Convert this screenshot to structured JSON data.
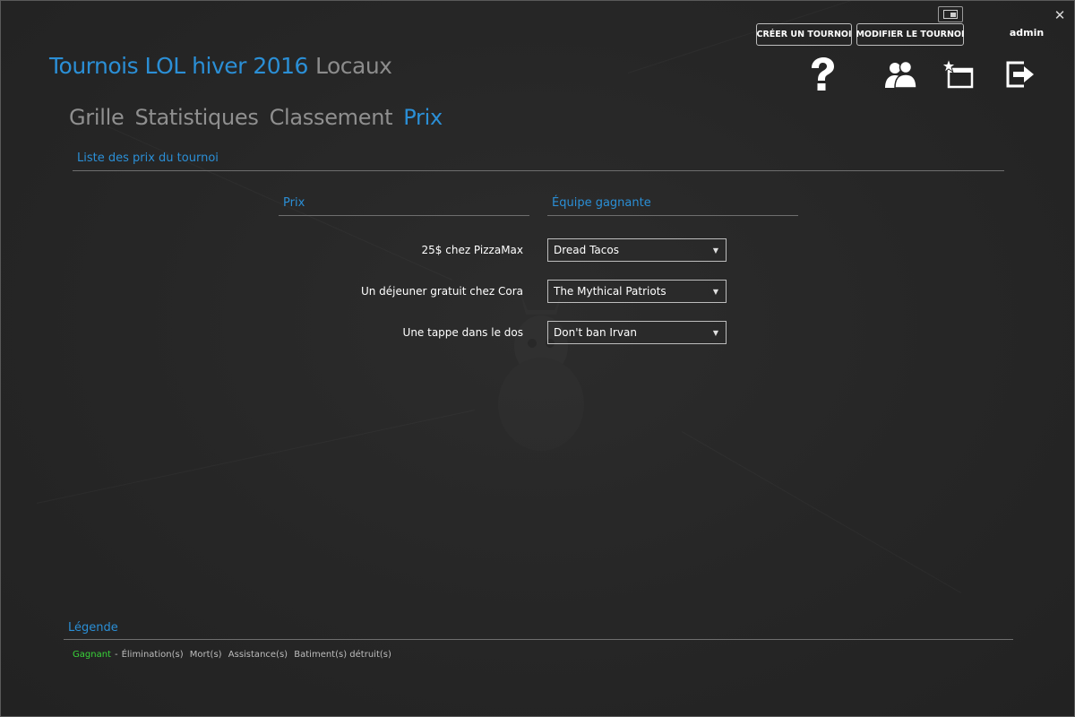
{
  "window": {
    "user": "admin"
  },
  "toolbar": {
    "create_label": "CRÉER UN TOURNOI",
    "modify_label": "MODIFIER LE TOURNOI",
    "icons": [
      "help-icon",
      "teams-icon",
      "new-window-icon",
      "logout-icon"
    ]
  },
  "header": {
    "title": "Tournois LOL hiver 2016",
    "subtitle": "Locaux"
  },
  "nav": {
    "tabs": [
      {
        "label": "Grille"
      },
      {
        "label": "Statistiques"
      },
      {
        "label": "Classement"
      },
      {
        "label": "Prix"
      }
    ],
    "active_index": 3
  },
  "main": {
    "section_title": "Liste des prix du tournoi",
    "columns": [
      "Prix",
      "Équipe gagnante"
    ],
    "rows": [
      {
        "prize": "25$ chez PizzaMax",
        "team": "Dread Tacos"
      },
      {
        "prize": "Un déjeuner gratuit chez Cora",
        "team": "The Mythical Patriots"
      },
      {
        "prize": "Une tappe dans le dos",
        "team": "Don't ban Irvan"
      }
    ]
  },
  "legend": {
    "title": "Légende",
    "winner": "Gagnant",
    "separator": "-",
    "items": [
      "Élimination(s)",
      "Mort(s)",
      "Assistance(s)",
      "Batiment(s) détruit(s)"
    ]
  },
  "colors": {
    "accent": "#2b8fd6",
    "muted": "#8f8f8f",
    "winner": "#39d439",
    "background": "#262626"
  }
}
